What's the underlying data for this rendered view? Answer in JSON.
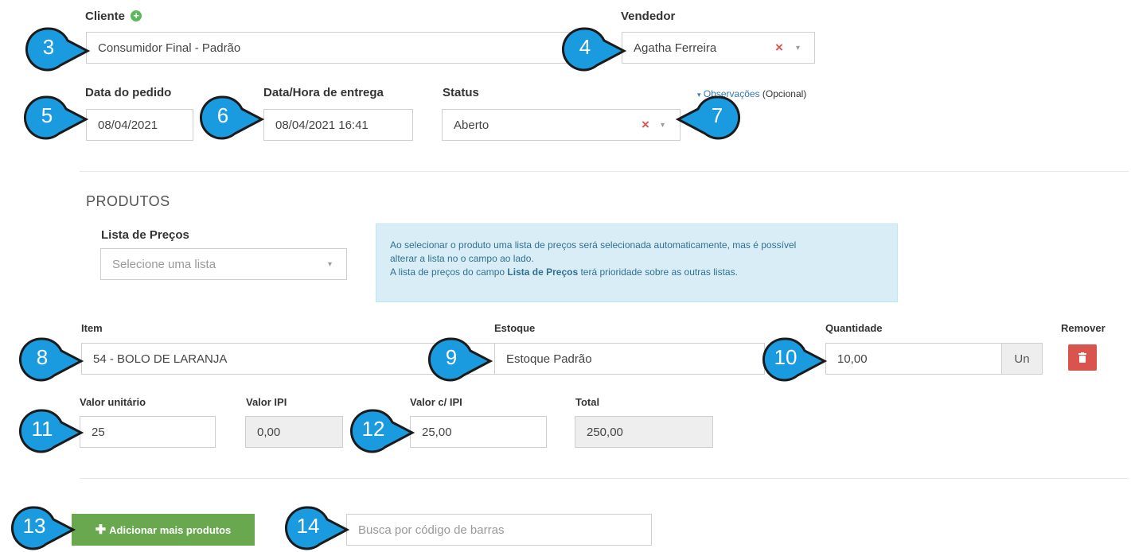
{
  "cliente": {
    "label": "Cliente",
    "value": "Consumidor Final - Padrão"
  },
  "vendedor": {
    "label": "Vendedor",
    "value": "Agatha Ferreira",
    "clear": "×",
    "caret": "▾"
  },
  "data_pedido": {
    "label": "Data do pedido",
    "value": "08/04/2021"
  },
  "data_entrega": {
    "label": "Data/Hora de entrega",
    "value": "08/04/2021 16:41"
  },
  "status": {
    "label": "Status",
    "value": "Aberto",
    "clear": "×",
    "caret": "▾"
  },
  "observacoes": {
    "caret": "▾",
    "label": "Observações",
    "optional": "(Opcional)"
  },
  "produtos": {
    "heading": "PRODUTOS",
    "lista_precos": {
      "label": "Lista de Preços",
      "placeholder": "Selecione uma lista",
      "caret": "▾"
    },
    "info": {
      "line1": "Ao selecionar o produto uma lista de preços será selecionada automaticamente, mas é possível",
      "line2": "alterar a lista no o campo ao lado.",
      "line3_pre": "A lista de preços do campo ",
      "line3_bold": "Lista de Preços",
      "line3_post": " terá prioridade sobre as outras listas."
    }
  },
  "item": {
    "label": "Item",
    "value": "54 - BOLO DE LARANJA"
  },
  "estoque": {
    "label": "Estoque",
    "value": "Estoque Padrão"
  },
  "quantidade": {
    "label": "Quantidade",
    "value": "10,00",
    "unit": "Un"
  },
  "remover": {
    "label": "Remover"
  },
  "valor_unitario": {
    "label": "Valor unitário",
    "value": "25"
  },
  "valor_ipi": {
    "label": "Valor IPI",
    "value": "0,00"
  },
  "valor_com_ipi": {
    "label": "Valor c/ IPI",
    "value": "25,00"
  },
  "total": {
    "label": "Total",
    "value": "250,00"
  },
  "add_button": {
    "label": "Adicionar mais produtos"
  },
  "barcode_search": {
    "placeholder": "Busca por código de barras"
  },
  "callouts": [
    "3",
    "4",
    "5",
    "6",
    "7",
    "8",
    "9",
    "10",
    "11",
    "12",
    "13",
    "14"
  ],
  "colors": {
    "callout": "#1a9be0",
    "add_button": "#6aa84f",
    "remove_button": "#d9534f",
    "info_bg": "#d9edf7"
  }
}
